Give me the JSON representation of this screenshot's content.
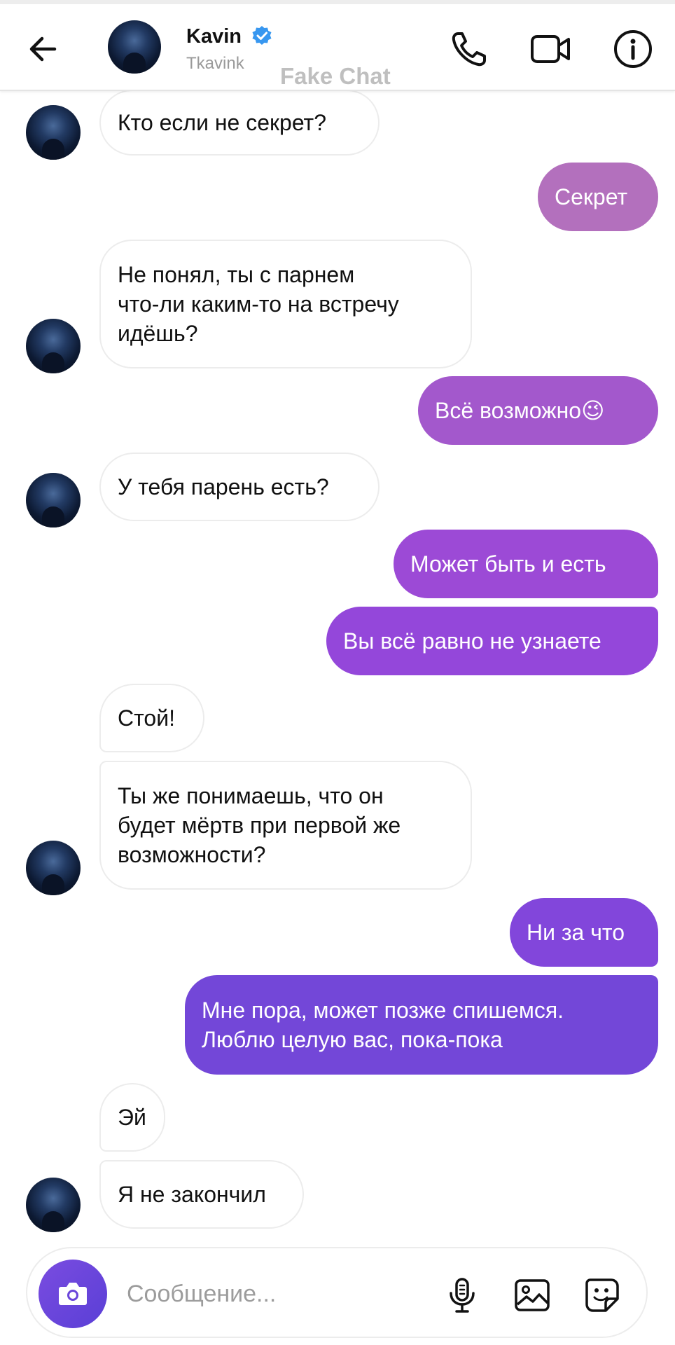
{
  "header": {
    "name": "Kavin",
    "username": "Tkavink",
    "watermark": "Fake Chat"
  },
  "messages": [
    {
      "side": "in",
      "text": "Кто если не секрет?"
    },
    {
      "side": "out",
      "text": "Секрет"
    },
    {
      "side": "in",
      "text": "Не понял, ты с парнем\nчто-ли каким-то на встречу\nидёшь?"
    },
    {
      "side": "out",
      "text": "Всё возможно😉"
    },
    {
      "side": "in",
      "text": "У тебя парень есть?"
    },
    {
      "side": "out",
      "text": "Может быть и есть"
    },
    {
      "side": "out",
      "text": "Вы всё равно не узнаете"
    },
    {
      "side": "in",
      "text": "Стой!"
    },
    {
      "side": "in",
      "text": "Ты же понимаешь, что он\nбудет мёртв при первой же\nвозможности?"
    },
    {
      "side": "out",
      "text": "Ни за что"
    },
    {
      "side": "out",
      "text": "Мне пора, может позже спишемся.\nЛюблю целую вас, пока-пока"
    },
    {
      "side": "in",
      "text": "Эй"
    },
    {
      "side": "in",
      "text": "Я не закончил"
    }
  ],
  "composer": {
    "placeholder": "Сообщение..."
  },
  "colors": {
    "out_top": "#b370bd",
    "out_mid": "#9849d8",
    "out_bottom": "#7347d8",
    "incoming_border": "#ececec",
    "verified": "#3797f0"
  },
  "icons": [
    "back-arrow-icon",
    "verified-badge-icon",
    "phone-icon",
    "video-camera-icon",
    "info-icon",
    "camera-icon",
    "microphone-icon",
    "image-icon",
    "sticker-icon"
  ]
}
